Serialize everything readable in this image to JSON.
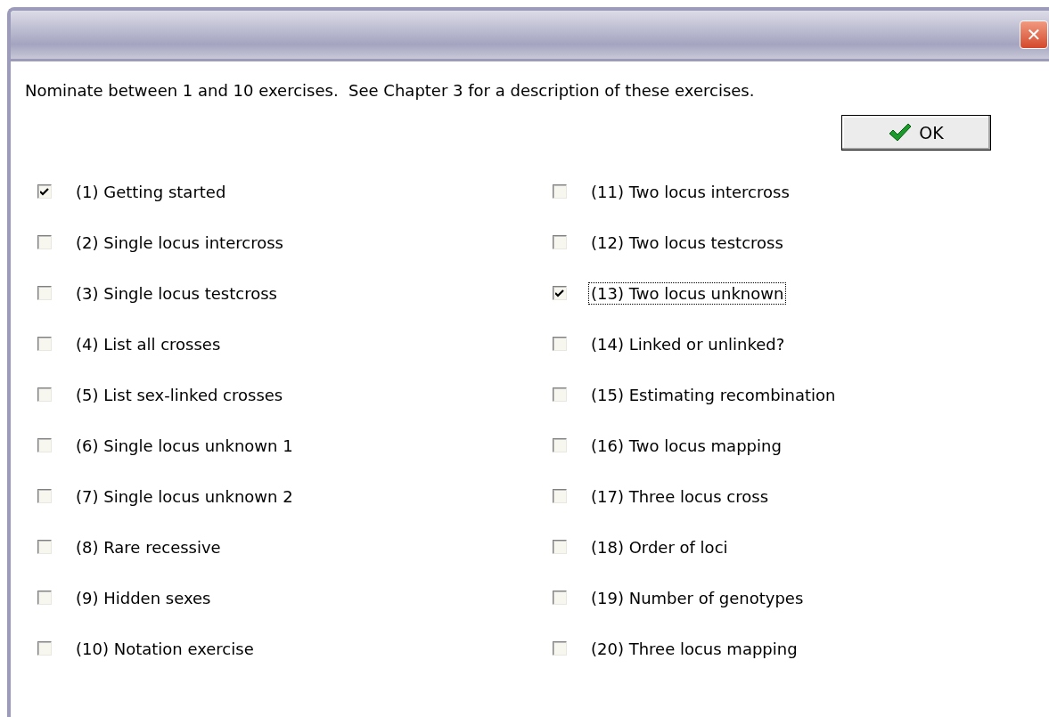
{
  "window": {
    "close_label": "✕"
  },
  "instruction": "Nominate between 1 and 10 exercises.  See Chapter 3 for a description of these exercises.",
  "ok_button": {
    "label": "OK"
  },
  "columns": [
    {
      "items": [
        {
          "label": "(1) Getting started",
          "checked": true,
          "focused": false
        },
        {
          "label": "(2) Single locus intercross",
          "checked": false,
          "focused": false
        },
        {
          "label": "(3) Single locus testcross",
          "checked": false,
          "focused": false
        },
        {
          "label": "(4) List all crosses",
          "checked": false,
          "focused": false
        },
        {
          "label": "(5) List sex-linked crosses",
          "checked": false,
          "focused": false
        },
        {
          "label": "(6) Single locus unknown 1",
          "checked": false,
          "focused": false
        },
        {
          "label": "(7) Single locus unknown 2",
          "checked": false,
          "focused": false
        },
        {
          "label": "(8) Rare recessive",
          "checked": false,
          "focused": false
        },
        {
          "label": "(9) Hidden sexes",
          "checked": false,
          "focused": false
        },
        {
          "label": "(10) Notation exercise",
          "checked": false,
          "focused": false
        }
      ]
    },
    {
      "items": [
        {
          "label": "(11) Two locus intercross",
          "checked": false,
          "focused": false
        },
        {
          "label": "(12) Two locus testcross",
          "checked": false,
          "focused": false
        },
        {
          "label": "(13) Two locus unknown",
          "checked": true,
          "focused": true
        },
        {
          "label": "(14) Linked or unlinked?",
          "checked": false,
          "focused": false
        },
        {
          "label": "(15) Estimating recombination",
          "checked": false,
          "focused": false
        },
        {
          "label": "(16) Two locus mapping",
          "checked": false,
          "focused": false
        },
        {
          "label": "(17) Three locus cross",
          "checked": false,
          "focused": false
        },
        {
          "label": "(18) Order of loci",
          "checked": false,
          "focused": false
        },
        {
          "label": "(19) Number of genotypes",
          "checked": false,
          "focused": false
        },
        {
          "label": "(20) Three locus mapping",
          "checked": false,
          "focused": false
        }
      ]
    }
  ]
}
